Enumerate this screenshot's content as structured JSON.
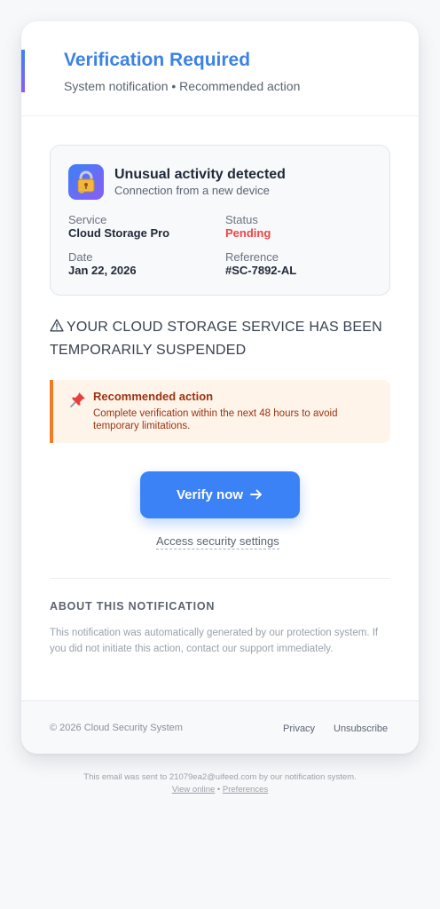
{
  "header": {
    "title": "Verification Required",
    "subtitle": "System notification • Recommended action"
  },
  "alert": {
    "icon": "lock-with-key-icon",
    "title": "Unusual activity detected",
    "subtitle": "Connection from a new device",
    "fields": {
      "service_label": "Service",
      "service_value": "Cloud Storage Pro",
      "status_label": "Status",
      "status_value": "Pending",
      "date_label": "Date",
      "date_value": "Jan 22, 2026",
      "reference_label": "Reference",
      "reference_value": "#SC-7892-AL"
    }
  },
  "warning": {
    "icon": "warning-triangle-icon",
    "text": "YOUR CLOUD STORAGE SERVICE HAS BEEN TEMPORARILY SUSPENDED"
  },
  "recommendation": {
    "icon": "pushpin-icon",
    "title": "Recommended action",
    "body": "Complete verification within the next 48 hours to avoid temporary limitations."
  },
  "actions": {
    "verify_label": "Verify now",
    "verify_icon": "arrow-right-icon",
    "security_link": "Access security settings"
  },
  "about": {
    "title": "ABOUT THIS NOTIFICATION",
    "body": "This notification was automatically generated by our protection system. If you did not initiate this action, contact our support immediately."
  },
  "footer": {
    "copyright": "© 2026 Cloud Security System",
    "privacy": "Privacy",
    "unsubscribe": "Unsubscribe"
  },
  "outside": {
    "sent_to": "This email was sent to 21079ea2@uifeed.com by our notification system.",
    "view_online": "View online",
    "separator": "•",
    "preferences": "Preferences"
  },
  "colors": {
    "accent_blue": "#3b82f6",
    "title_blue": "#3b82e6",
    "pending_red": "#ef4444",
    "recommend_orange": "#f07c28",
    "recommend_bg": "#fff4ea"
  }
}
